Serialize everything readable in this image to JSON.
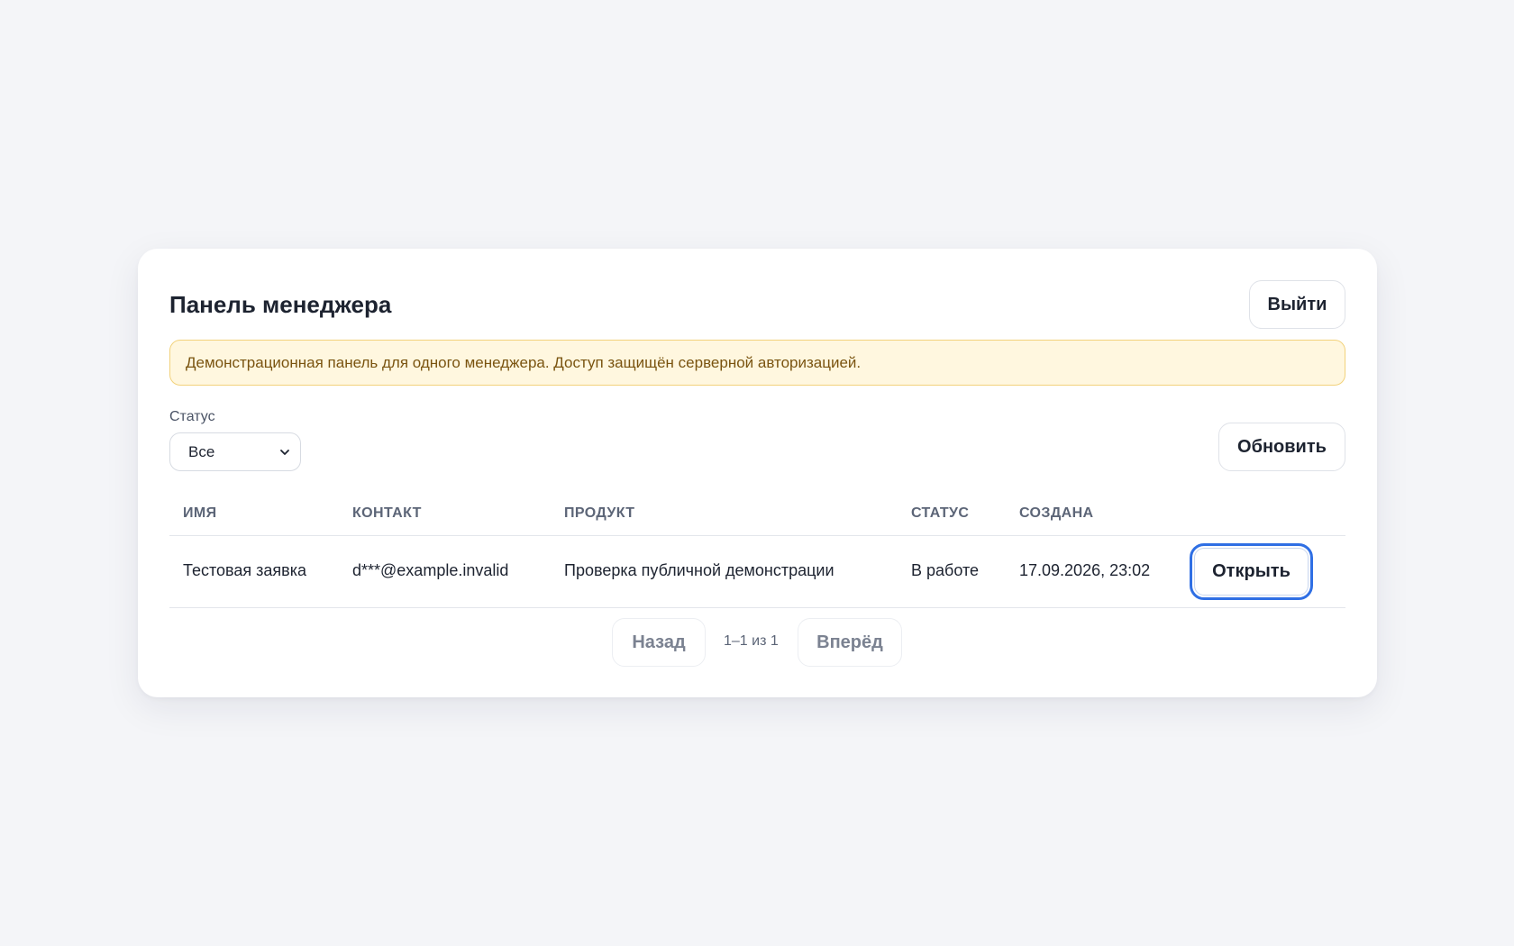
{
  "header": {
    "title": "Панель менеджера",
    "logout_label": "Выйти"
  },
  "notice": {
    "text": "Демонстрационная панель для одного менеджера. Доступ защищён серверной авторизацией."
  },
  "filter": {
    "label": "Статус",
    "selected": "Все"
  },
  "refresh_label": "Обновить",
  "table": {
    "columns": [
      "ИМЯ",
      "КОНТАКТ",
      "ПРОДУКТ",
      "СТАТУС",
      "СОЗДАНА"
    ],
    "rows": [
      {
        "name": "Тестовая заявка",
        "contact": "d***@example.invalid",
        "product": "Проверка публичной демонстрации",
        "status": "В работе",
        "created": "17.09.2026, 23:02",
        "action_label": "Открыть"
      }
    ]
  },
  "pagination": {
    "prev_label": "Назад",
    "info": "1–1 из 1",
    "next_label": "Вперёд"
  }
}
